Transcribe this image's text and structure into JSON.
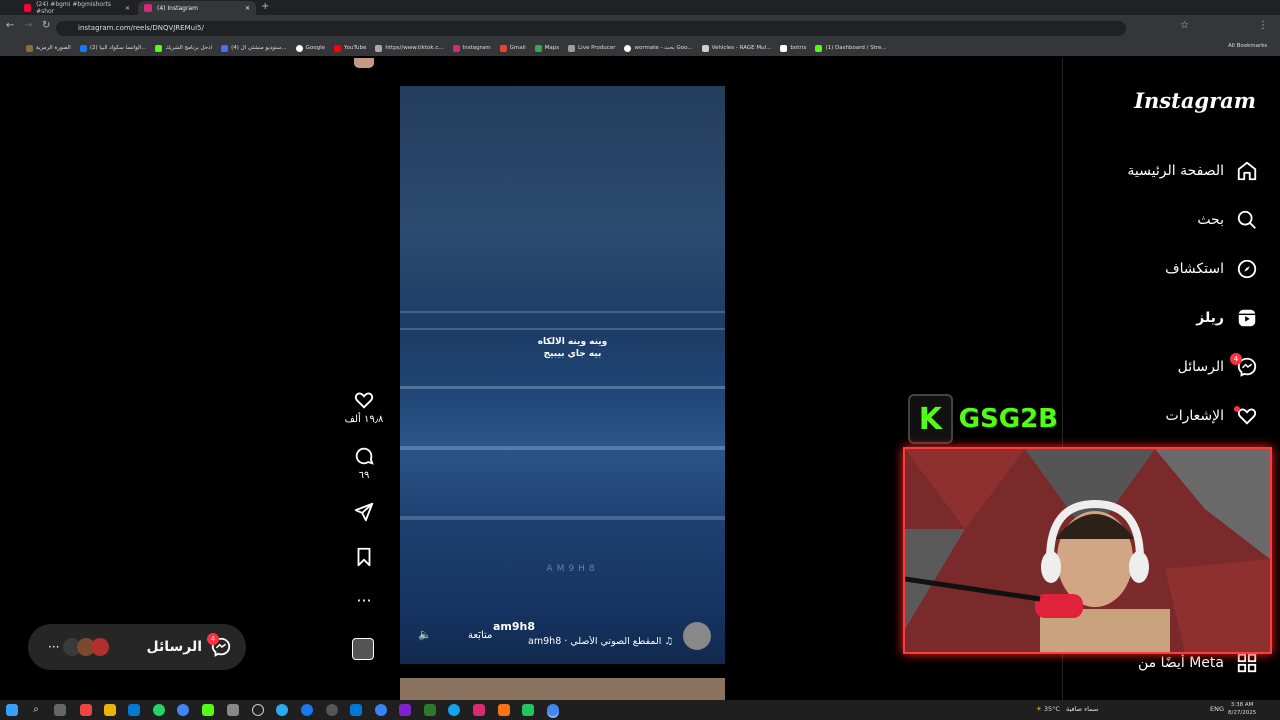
{
  "browser": {
    "tabs": [
      {
        "title": "(24) #bgmi #bgmishorts #shor",
        "color": "#ff0033"
      },
      {
        "title": "(4) Instagram",
        "color": "#d62976",
        "active": true
      }
    ],
    "url": "instagram.com/reels/DNQVJREMui5/",
    "bookmarks": [
      {
        "label": "الصورة الرمزية",
        "color": "#8a6d3b"
      },
      {
        "label": "(2) الواتسا سكواد البيا...",
        "color": "#1877f2"
      },
      {
        "label": "ادخل برنامج الشريك",
        "color": "#53fc18"
      },
      {
        "label": "(4) ستوديو منشئي ال...",
        "color": "#4c6ef5"
      },
      {
        "label": "Google",
        "color": "#ffffff"
      },
      {
        "label": "YouTube",
        "color": "#ff0000"
      },
      {
        "label": "https//www.tiktok.c...",
        "color": "#aaaaaa"
      },
      {
        "label": "Instagram",
        "color": "#d62976"
      },
      {
        "label": "Gmail",
        "color": "#ea4335"
      },
      {
        "label": "Maps",
        "color": "#34a853"
      },
      {
        "label": "Live Producer",
        "color": "#9e9e9e"
      },
      {
        "label": "wormate - بحث Goo...",
        "color": "#ffffff"
      },
      {
        "label": "Vehicles - RAGE Mul...",
        "color": "#cccccc"
      },
      {
        "label": "botrix",
        "color": "#ffffff"
      },
      {
        "label": "(1) Dashboard / Stre...",
        "color": "#53fc18"
      }
    ],
    "all_bookmarks": "All Bookmarks"
  },
  "instagram": {
    "logo": "Instagram",
    "nav": [
      {
        "label": "الصفحة الرئيسية",
        "icon": "home-icon"
      },
      {
        "label": "بحث",
        "icon": "search-icon"
      },
      {
        "label": "استكشاف",
        "icon": "explore-icon"
      },
      {
        "label": "ريلز",
        "icon": "reels-icon"
      },
      {
        "label": "الرسائل",
        "icon": "messenger-icon",
        "badge": "4"
      },
      {
        "label": "الإشعارات",
        "icon": "heart-icon",
        "dot": true
      }
    ],
    "more": "أيضًا من Meta"
  },
  "reel": {
    "caption_line1": "وينه وينه الالكاه",
    "caption_line2": "بيه جاي بيبيج",
    "watermark": "AM9H8",
    "username": "am9h8",
    "follow": "متابَعة",
    "audio": "المقطع الصوتي الأصلي · am9h8",
    "likes": "١٩٫٨ ألف",
    "comments": "٦٩"
  },
  "messages_pill": {
    "label": "الرسائل",
    "badge": "4"
  },
  "overlay": {
    "brand": "GSG2B",
    "accent": "#53fc18",
    "frame": "#ff3b3b"
  },
  "taskbar": {
    "temp": "35°C",
    "weather": "سماء صافية",
    "lang": "ENG",
    "time": "3:38 AM",
    "date": "8/27/2025"
  }
}
